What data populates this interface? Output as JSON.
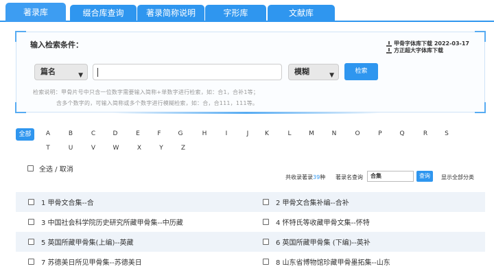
{
  "tabs": [
    {
      "label": "著录库",
      "active": true
    },
    {
      "label": "缀合库查询"
    },
    {
      "label": "著录简称说明"
    },
    {
      "label": "字形库"
    },
    {
      "label": "文献库"
    }
  ],
  "search": {
    "title": "输入检索条件：",
    "downloads": [
      "甲骨字体库下载 2022-03-17",
      "方正超大字体库下载"
    ],
    "field_select": "篇名",
    "input_value": "",
    "mode_select": "模糊",
    "button": "检索",
    "hint_line1": "检索说明：甲骨片号中只含一位数字需要输入简称+单数字进行检索，如：合1，合补1等；",
    "hint_line2": "含多个数字的，可输入简称或多个数字进行模糊检索，如：合，合111，111等。"
  },
  "alphabet": {
    "all": "全部",
    "row1": [
      "A",
      "B",
      "C",
      "D",
      "E",
      "F",
      "G",
      "H",
      "I",
      "J",
      "K",
      "L",
      "M",
      "N",
      "O",
      "P",
      "Q",
      "R",
      "S"
    ],
    "row2": [
      "T",
      "U",
      "V",
      "W",
      "X",
      "Y",
      "Z"
    ]
  },
  "toolbar": {
    "select_all": "全选 / 取消",
    "stats_prefix": "共收录著录",
    "stats_count": "39",
    "stats_suffix": "种",
    "name_query_label": "著录名查询",
    "name_query_value": "合集",
    "query_button": "查询",
    "show_all": "显示全部分类"
  },
  "catalog": [
    [
      "1 甲骨文合集--合",
      "2 甲骨文合集补编--合补"
    ],
    [
      "3 中国社会科学院历史研究所藏甲骨集--中历藏",
      "4 怀特氏等收藏甲骨文集--怀特"
    ],
    [
      "5 英国所藏甲骨集(上编)--英藏",
      "6 英国所藏甲骨集 (下编)--英补"
    ],
    [
      "7 苏德美日所见甲骨集--苏德美日",
      "8 山东省博物馆珍藏甲骨墨拓集--山东"
    ]
  ],
  "colors": {
    "accent": "#2f96ef",
    "row_shade": "#eef3f9"
  }
}
